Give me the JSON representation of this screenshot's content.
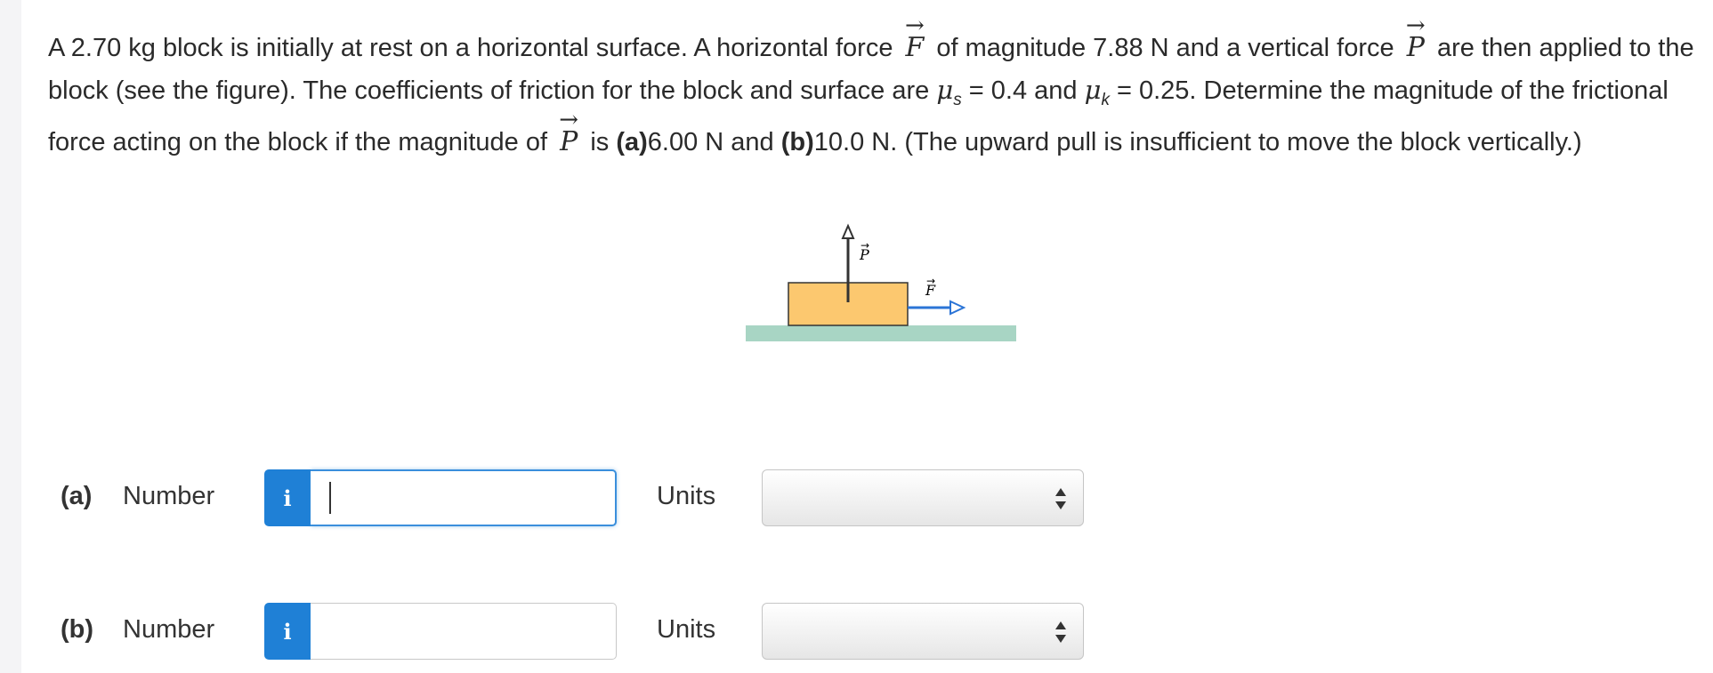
{
  "question": {
    "t1": "A 2.70 kg block is initially at rest on a horizontal surface. A horizontal force",
    "vecF": "F",
    "t2": "of magnitude 7.88 N and a vertical force",
    "vecP": "P",
    "t3": "are then applied to the block (see the figure). The coefficients of friction for the block and surface are",
    "mu": "μ",
    "sub_s": "s",
    "t4": "= 0.4 and",
    "sub_k": "k",
    "t5": "= 0.25. Determine the magnitude of the frictional force acting on the block if the magnitude of",
    "t6": "is",
    "part_a": "(a)",
    "t7": "6.00 N and",
    "part_b": "(b)",
    "t8": "10.0 N. (The upward pull is insufficient to move the block vertically.)"
  },
  "figure": {
    "label_P": "P",
    "label_F": "F",
    "colors": {
      "block": "#fcc86f",
      "ground": "#a8d5c4",
      "arrow_F": "#2b74d6",
      "arrow_P": "#333333"
    }
  },
  "answers": [
    {
      "part": "(a)",
      "number_label": "Number",
      "info": "i",
      "value": "",
      "units_label": "Units",
      "units_value": ""
    },
    {
      "part": "(b)",
      "number_label": "Number",
      "info": "i",
      "value": "",
      "units_label": "Units",
      "units_value": ""
    }
  ],
  "colors": {
    "info_button": "#1f80d6",
    "focus_border": "#3a8fdc"
  }
}
